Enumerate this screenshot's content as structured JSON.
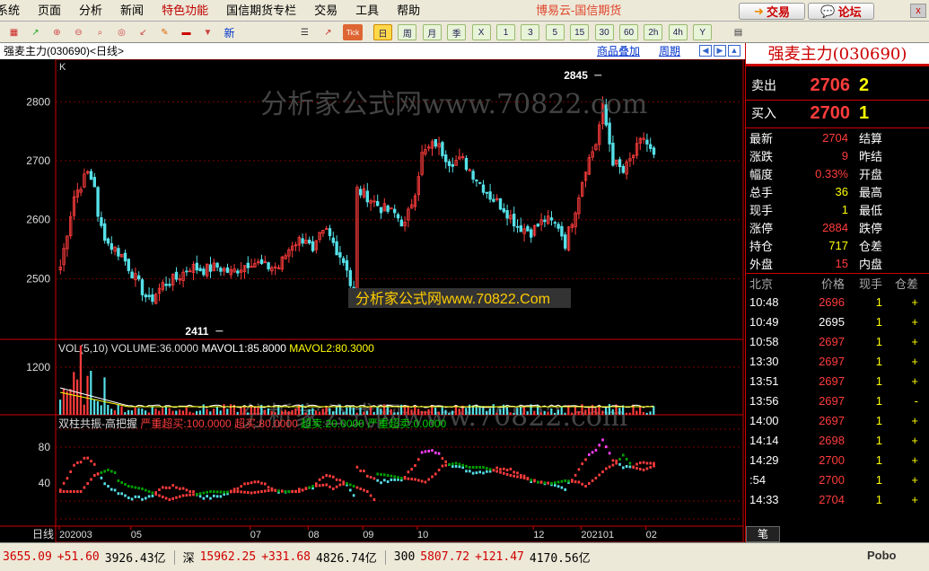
{
  "menubar": {
    "items": [
      {
        "label": "系统",
        "special": false
      },
      {
        "label": "页面",
        "special": false
      },
      {
        "label": "分析",
        "special": false
      },
      {
        "label": "新闻",
        "special": false
      },
      {
        "label": "特色功能",
        "special": true
      },
      {
        "label": "国信期货专栏",
        "special": false
      },
      {
        "label": "交易",
        "special": false
      },
      {
        "label": "工具",
        "special": false
      },
      {
        "label": "帮助",
        "special": false
      }
    ],
    "brand": "博易云-国信期货",
    "trade_button": "交易",
    "forum_button": "论坛",
    "close_label": "x"
  },
  "toolbar": {
    "periods": [
      "日",
      "周",
      "月",
      "季",
      "X",
      "1",
      "3",
      "5",
      "15",
      "30",
      "60",
      "2h",
      "4h",
      "Y"
    ],
    "active_period": "日",
    "tick_label": "Tick",
    "new_label": "新"
  },
  "chart": {
    "header_title": "强麦主力(030690)<日线>",
    "overlay_link": "商品叠加",
    "period_link": "周期",
    "k_label": "K",
    "watermark1": "分析家公式网www.70822.com",
    "watermark2": "分析家公式网www.70822.Com",
    "watermark3": "分析家公式网www.70822.com",
    "period_tag": "日线"
  },
  "chart_data": {
    "type": "candlestick",
    "price_axis": {
      "ticks": [
        2500,
        2600,
        2700,
        2800
      ],
      "ylim": [
        2400,
        2860
      ]
    },
    "max_label": "2845",
    "min_label": "2411",
    "x_tick_labels": [
      "202003",
      "05",
      "07",
      "08",
      "09",
      "10",
      "12",
      "202101",
      "02"
    ],
    "x_tick_positions": [
      0,
      21,
      56,
      73,
      89,
      105,
      139,
      153,
      172
    ],
    "candles_count": 182,
    "price_anchors": [
      [
        0,
        2520
      ],
      [
        4,
        2640
      ],
      [
        8,
        2680
      ],
      [
        10,
        2660
      ],
      [
        11,
        2600
      ],
      [
        14,
        2560
      ],
      [
        18,
        2540
      ],
      [
        22,
        2500
      ],
      [
        26,
        2460
      ],
      [
        30,
        2490
      ],
      [
        34,
        2500
      ],
      [
        38,
        2520
      ],
      [
        42,
        2515
      ],
      [
        46,
        2520
      ],
      [
        50,
        2510
      ],
      [
        56,
        2530
      ],
      [
        60,
        2520
      ],
      [
        64,
        2520
      ],
      [
        68,
        2560
      ],
      [
        72,
        2570
      ],
      [
        74,
        2540
      ],
      [
        76,
        2570
      ],
      [
        78,
        2580
      ],
      [
        82,
        2540
      ],
      [
        84,
        2520
      ],
      [
        86,
        2460
      ],
      [
        87,
        2650
      ],
      [
        90,
        2640
      ],
      [
        94,
        2620
      ],
      [
        98,
        2610
      ],
      [
        101,
        2590
      ],
      [
        104,
        2650
      ],
      [
        106,
        2710
      ],
      [
        110,
        2730
      ],
      [
        114,
        2700
      ],
      [
        118,
        2700
      ],
      [
        122,
        2670
      ],
      [
        126,
        2640
      ],
      [
        130,
        2620
      ],
      [
        134,
        2590
      ],
      [
        138,
        2580
      ],
      [
        142,
        2600
      ],
      [
        146,
        2590
      ],
      [
        148,
        2560
      ],
      [
        151,
        2620
      ],
      [
        154,
        2690
      ],
      [
        157,
        2730
      ],
      [
        159,
        2790
      ],
      [
        162,
        2700
      ],
      [
        165,
        2680
      ],
      [
        168,
        2710
      ],
      [
        171,
        2740
      ],
      [
        174,
        2705
      ]
    ],
    "volume": {
      "label": "VOL(5,10)",
      "volume_text": "VOLUME:36.0000",
      "mavol1_text": "MAVOL1:85.8000",
      "mavol2_text": "MAVOL2:80.3000",
      "ticks": [
        1200
      ]
    },
    "oscillator": {
      "name": "双柱共振-高把握",
      "labels": [
        "严重超买:100.0000",
        "超买:80.0000",
        "超卖:20.0000",
        "严重超卖:0.0000"
      ],
      "ticks": [
        40,
        80
      ]
    }
  },
  "quote": {
    "title": "强麦主力(030690)",
    "ask": {
      "label": "卖出",
      "price": "2706",
      "vol": "2"
    },
    "bid": {
      "label": "买入",
      "price": "2700",
      "vol": "1"
    },
    "stats": [
      {
        "l": "最新",
        "v": "2704",
        "c": "red",
        "r": "结算"
      },
      {
        "l": "涨跌",
        "v": "9",
        "c": "red",
        "r": "昨结"
      },
      {
        "l": "幅度",
        "v": "0.33%",
        "c": "red",
        "r": "开盘"
      },
      {
        "l": "总手",
        "v": "36",
        "c": "yellow",
        "r": "最高"
      },
      {
        "l": "现手",
        "v": "1",
        "c": "yellow",
        "r": "最低"
      },
      {
        "l": "涨停",
        "v": "2884",
        "c": "red",
        "r": "跌停"
      },
      {
        "l": "持仓",
        "v": "717",
        "c": "yellow",
        "r": "仓差"
      },
      {
        "l": "外盘",
        "v": "15",
        "c": "red",
        "r": "内盘"
      }
    ],
    "tick_headers": [
      "北京",
      "价格",
      "现手",
      "仓差"
    ],
    "ticks": [
      {
        "t": "10:48",
        "p": "2696",
        "pc": "red",
        "v": "1",
        "f": "+"
      },
      {
        "t": "10:49",
        "p": "2695",
        "pc": "white",
        "v": "1",
        "f": "+"
      },
      {
        "t": "10:58",
        "p": "2697",
        "pc": "red",
        "v": "1",
        "f": "+"
      },
      {
        "t": "13:30",
        "p": "2697",
        "pc": "red",
        "v": "1",
        "f": "+"
      },
      {
        "t": "13:51",
        "p": "2697",
        "pc": "red",
        "v": "1",
        "f": "+"
      },
      {
        "t": "13:56",
        "p": "2697",
        "pc": "red",
        "v": "1",
        "f": "-"
      },
      {
        "t": "14:00",
        "p": "2697",
        "pc": "red",
        "v": "1",
        "f": "+"
      },
      {
        "t": "14:14",
        "p": "2698",
        "pc": "red",
        "v": "1",
        "f": "+"
      },
      {
        "t": "14:29",
        "p": "2700",
        "pc": "red",
        "v": "1",
        "f": "+"
      },
      {
        "t": ":54",
        "p": "2700",
        "pc": "red",
        "v": "1",
        "f": "+"
      },
      {
        "t": "14:33",
        "p": "2704",
        "pc": "red",
        "v": "1",
        "f": "+"
      }
    ],
    "tab_label": "笔"
  },
  "statusbar": {
    "items": [
      {
        "text": "3655.09",
        "c": "red"
      },
      {
        "text": "+51.60",
        "c": "red"
      },
      {
        "text": "3926.43亿",
        "c": "black"
      },
      {
        "text": "|",
        "c": "sep"
      },
      {
        "text": "深",
        "c": "black"
      },
      {
        "text": "15962.25",
        "c": "red"
      },
      {
        "text": "+331.68",
        "c": "red"
      },
      {
        "text": "4826.74亿",
        "c": "black"
      },
      {
        "text": "|",
        "c": "sep"
      },
      {
        "text": "300",
        "c": "black"
      },
      {
        "text": "5807.72",
        "c": "red"
      },
      {
        "text": "+121.47",
        "c": "red"
      },
      {
        "text": "4170.56亿",
        "c": "black"
      }
    ],
    "logo": "Pobo"
  },
  "colors": {
    "up": "#ff3c3c",
    "down": "#55e0e8",
    "grid": "#7a0000",
    "accent": "#c00000"
  }
}
